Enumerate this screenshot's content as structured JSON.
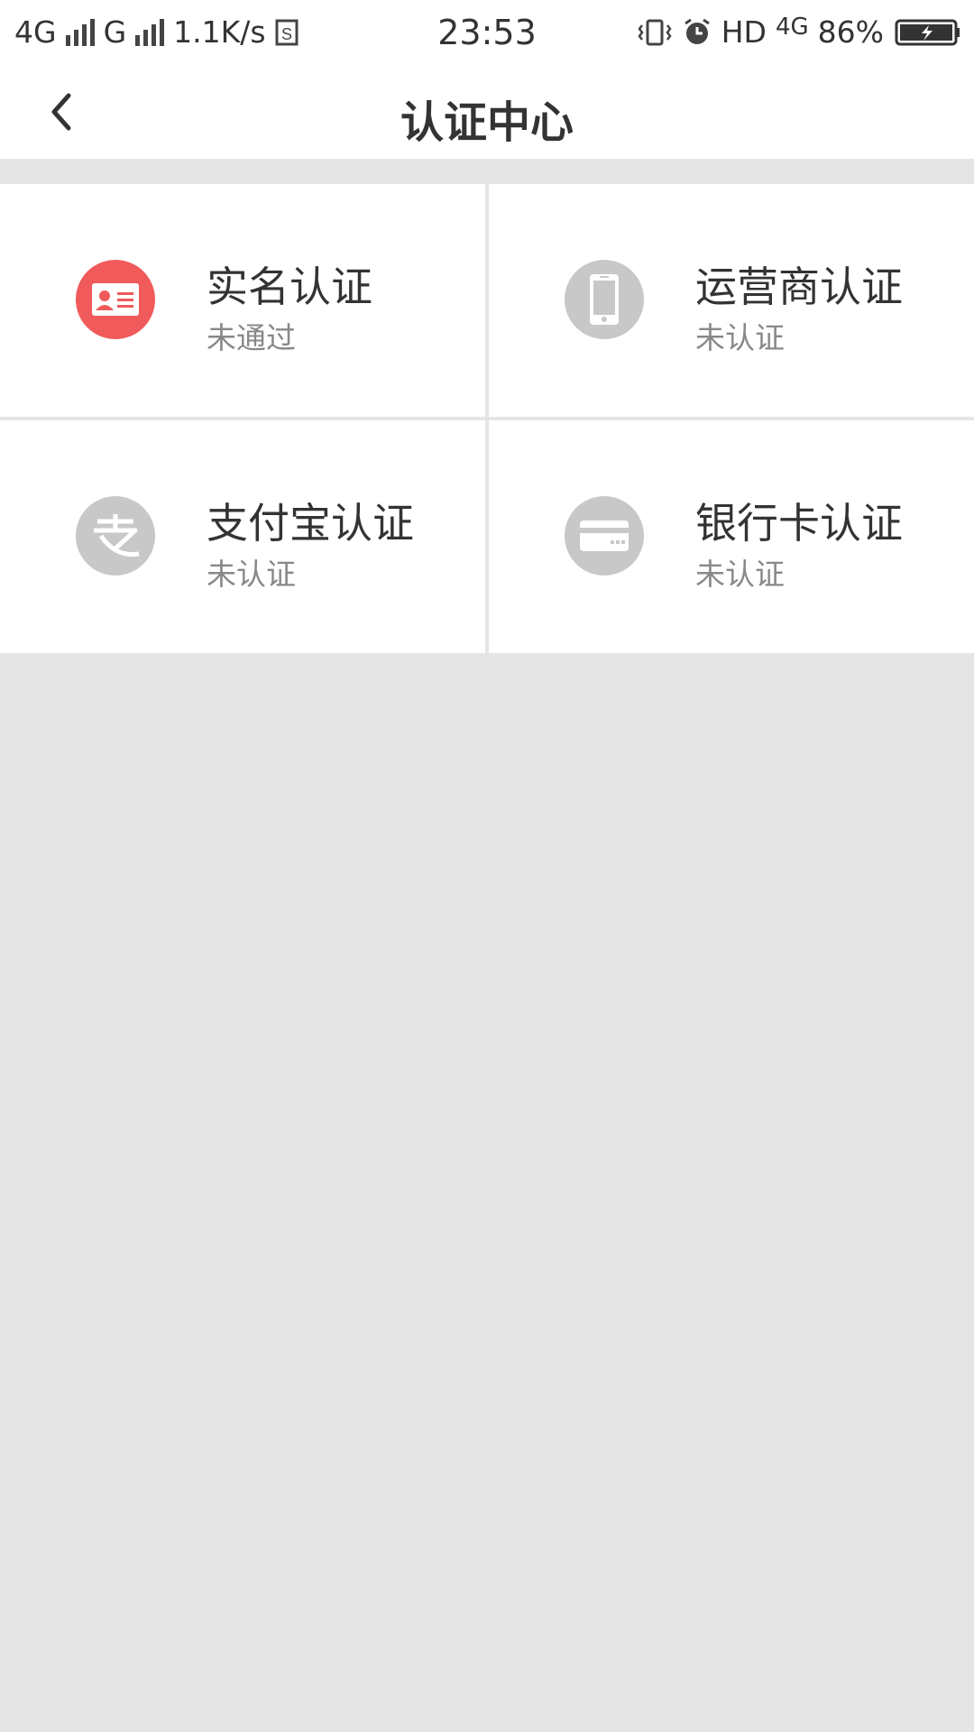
{
  "status_bar": {
    "network_1": "4G",
    "network_2": "G",
    "speed": "1.1K/s",
    "time": "23:53",
    "hd": "HD",
    "network_3": "4G",
    "battery": "86%"
  },
  "header": {
    "title": "认证中心"
  },
  "auth_items": [
    {
      "label": "实名认证",
      "status": "未通过",
      "icon": "id-card-icon",
      "color": "#f05a5a"
    },
    {
      "label": "运营商认证",
      "status": "未认证",
      "icon": "phone-icon",
      "color": "#c8c8c8"
    },
    {
      "label": "支付宝认证",
      "status": "未认证",
      "icon": "alipay-icon",
      "color": "#c8c8c8"
    },
    {
      "label": "银行卡认证",
      "status": "未认证",
      "icon": "bank-card-icon",
      "color": "#c8c8c8"
    }
  ]
}
